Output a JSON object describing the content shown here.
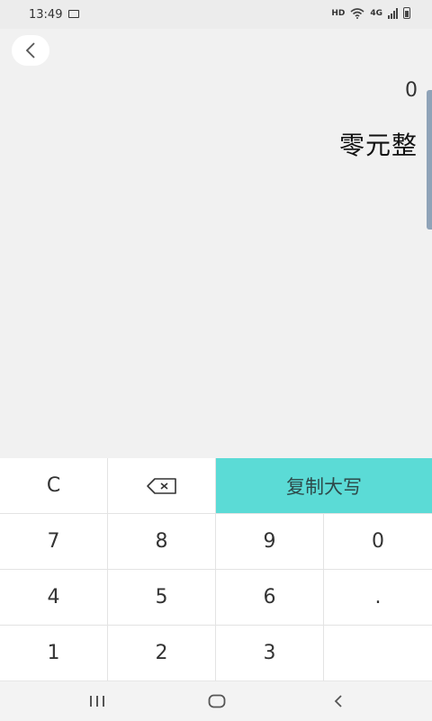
{
  "status": {
    "time": "13:49",
    "network": "HD",
    "cell_type": "4G"
  },
  "display": {
    "amount": "0",
    "amount_words": "零元整"
  },
  "keypad": {
    "clear": "C",
    "copy": "复制大写",
    "rows": [
      [
        "7",
        "8",
        "9",
        "0"
      ],
      [
        "4",
        "5",
        "6",
        "."
      ],
      [
        "1",
        "2",
        "3",
        ""
      ]
    ]
  },
  "colors": {
    "copy_button": "#5bdbd6",
    "background": "#f1f1f1"
  },
  "icons": {
    "back": "chevron-left-icon",
    "delete": "backspace-icon",
    "nav_recent": "recent-apps-icon",
    "nav_home": "home-icon",
    "nav_back": "nav-back-icon"
  }
}
